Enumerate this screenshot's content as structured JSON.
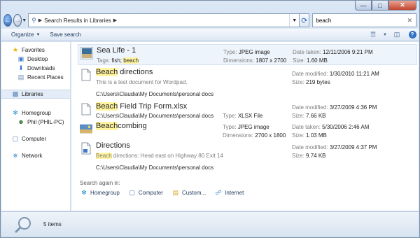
{
  "address": {
    "breadcrumb": "Search Results in Libraries"
  },
  "search": {
    "value": "beach"
  },
  "toolbar": {
    "organize": "Organize",
    "save_search": "Save search"
  },
  "nav": {
    "favorites": "Favorites",
    "desktop": "Desktop",
    "downloads": "Downloads",
    "recent": "Recent Places",
    "libraries": "Libraries",
    "homegroup": "Homegroup",
    "phil": "Phil (PHIL-PC)",
    "computer": "Computer",
    "network": "Network"
  },
  "results": [
    {
      "name_pre": "",
      "name_hl": "",
      "name_post": "Sea Life - 1",
      "tags_label": "Tags:",
      "tags_pre": "fish; ",
      "tags_hl": "beach",
      "type_label": "Type:",
      "type": "JPEG image",
      "dim_label": "Dimensions:",
      "dim": "1807 x 2700",
      "date_label": "Date taken:",
      "date": "12/11/2006 9:21 PM",
      "size_label": "Size:",
      "size": "1.60 MB"
    },
    {
      "name_pre": "",
      "name_hl": "Beach",
      "name_post": " directions",
      "desc": "This is a test document for Wordpad.",
      "path": "C:\\Users\\Claudia\\My Documents\\personal docs",
      "date_label": "Date modified:",
      "date": "1/30/2010 11:21 AM",
      "size_label": "Size:",
      "size": "219 bytes"
    },
    {
      "name_pre": "",
      "name_hl": "Beach",
      "name_post": " Field Trip Form.xlsx",
      "path": "C:\\Users\\Claudia\\My Documents\\personal docs",
      "type_label": "Type:",
      "type": "XLSX File",
      "date_label": "Date modified:",
      "date": "3/27/2009 4:36 PM",
      "size_label": "Size:",
      "size": "7.66 KB"
    },
    {
      "name_pre": "",
      "name_hl": "Beach",
      "name_post": "combing",
      "type_label": "Type:",
      "type": "JPEG image",
      "dim_label": "Dimensions:",
      "dim": "2700 x 1800",
      "date_label": "Date taken:",
      "date": "5/30/2006 2:46 AM",
      "size_label": "Size:",
      "size": "1.03 MB"
    },
    {
      "name_pre": "",
      "name_hl": "",
      "name_post": "Directions",
      "desc_hl": "Beach",
      "desc_post": " directions: Head east on Highway 80 Exit 14",
      "path": "C:\\Users\\Claudia\\My Documents\\personal docs",
      "date_label": "Date modified:",
      "date": "3/27/2009 4:37 PM",
      "size_label": "Size:",
      "size": "9.74 KB"
    }
  ],
  "search_again": {
    "label": "Search again in:",
    "homegroup": "Homegroup",
    "computer": "Computer",
    "custom": "Custom...",
    "internet": "Internet"
  },
  "status": {
    "count": "5 items"
  },
  "colors": {
    "highlight": "#fff4a0",
    "selection": "#eef4fb",
    "accent": "#1e395b"
  }
}
